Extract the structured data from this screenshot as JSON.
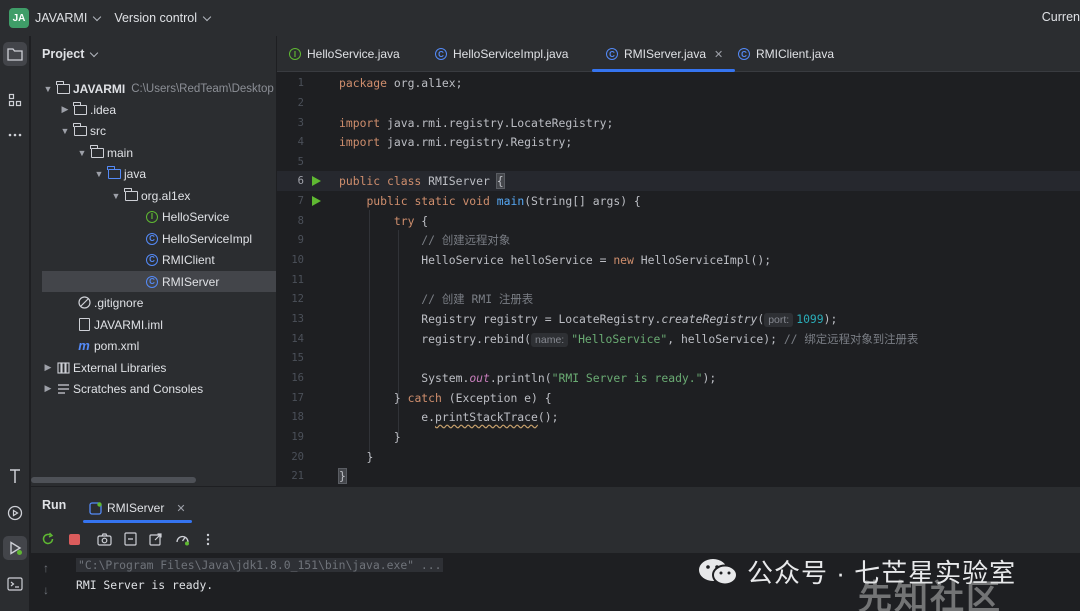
{
  "titlebar": {
    "badge": "JA",
    "project_name": "JAVARMI",
    "vcs_label": "Version control",
    "right_text": "Curren"
  },
  "project_panel": {
    "title": "Project",
    "root_name": "JAVARMI",
    "root_path": "C:\\Users\\RedTeam\\Desktop",
    "items": [
      {
        "label": ".idea"
      },
      {
        "label": "src"
      },
      {
        "label": "main"
      },
      {
        "label": "java"
      },
      {
        "label": "org.al1ex"
      },
      {
        "label": "HelloService"
      },
      {
        "label": "HelloServiceImpl"
      },
      {
        "label": "RMIClient"
      },
      {
        "label": "RMIServer"
      },
      {
        "label": ".gitignore"
      },
      {
        "label": "JAVARMI.iml"
      },
      {
        "label": "pom.xml"
      },
      {
        "label": "External Libraries"
      },
      {
        "label": "Scratches and Consoles"
      }
    ]
  },
  "tabs": [
    {
      "label": "HelloService.java",
      "icon": "interface-icon"
    },
    {
      "label": "HelloServiceImpl.java",
      "icon": "class-icon"
    },
    {
      "label": "RMIServer.java",
      "icon": "class-icon",
      "active": true
    },
    {
      "label": "RMIClient.java",
      "icon": "class-icon"
    }
  ],
  "editor": {
    "line_numbers": [
      "1",
      "2",
      "3",
      "4",
      "5",
      "6",
      "7",
      "8",
      "9",
      "10",
      "11",
      "12",
      "13",
      "14",
      "15",
      "16",
      "17",
      "18",
      "19",
      "20",
      "21"
    ],
    "code": {
      "l1_kw": "package",
      "l1_rest": " org.al1ex;",
      "l3_kw": "import",
      "l3_rest": " java.rmi.registry.LocateRegistry;",
      "l4_kw": "import",
      "l4_rest": " java.rmi.registry.Registry;",
      "l6_kw": "public class ",
      "l6_name": "RMIServer ",
      "l6_brace": "{",
      "l7_kw": "public static void ",
      "l7_fn": "main",
      "l7_rest": "(String[] args) {",
      "l8_kw": "try",
      "l8_rest": " {",
      "l9_cmt": "// 创建远程对象",
      "l10_a": "HelloService helloService = ",
      "l10_kw": "new",
      "l10_b": " HelloServiceImpl();",
      "l12_cmt": "// 创建 RMI 注册表",
      "l13_a": "Registry registry = LocateRegistry.",
      "l13_fn": "createRegistry",
      "l13_b": "(",
      "l13_hint": "port:",
      "l13_num": "1099",
      "l13_c": ");",
      "l14_a": "registry.rebind(",
      "l14_hint": "name:",
      "l14_str": "\"HelloService\"",
      "l14_b": ", helloService); ",
      "l14_cmt": "// 绑定远程对象到注册表",
      "l16_a": "System.",
      "l16_out": "out",
      "l16_b": ".println(",
      "l16_str": "\"RMI Server is ready.\"",
      "l16_c": ");",
      "l17_a": "} ",
      "l17_kw": "catch",
      "l17_b": " (Exception e) {",
      "l18_a": "e.",
      "l18_warn": "printStackTrace",
      "l18_b": "();",
      "l19": "}",
      "l20": "}",
      "l21": "}"
    }
  },
  "run_panel": {
    "title": "Run",
    "tab_label": "RMIServer",
    "console_lines": [
      "\"C:\\Program Files\\Java\\jdk1.8.0_151\\bin\\java.exe\" ...",
      "RMI Server is ready."
    ]
  },
  "watermark": {
    "text": "公众号 · 七芒星实验室",
    "text2": "先知社区"
  },
  "colors": {
    "accent": "#3574f0",
    "keyword": "#cf8e6d",
    "string": "#6aab73",
    "function": "#56a8f5",
    "number": "#2aacb8",
    "comment": "#7a7e85",
    "run_green": "#5fb832"
  }
}
